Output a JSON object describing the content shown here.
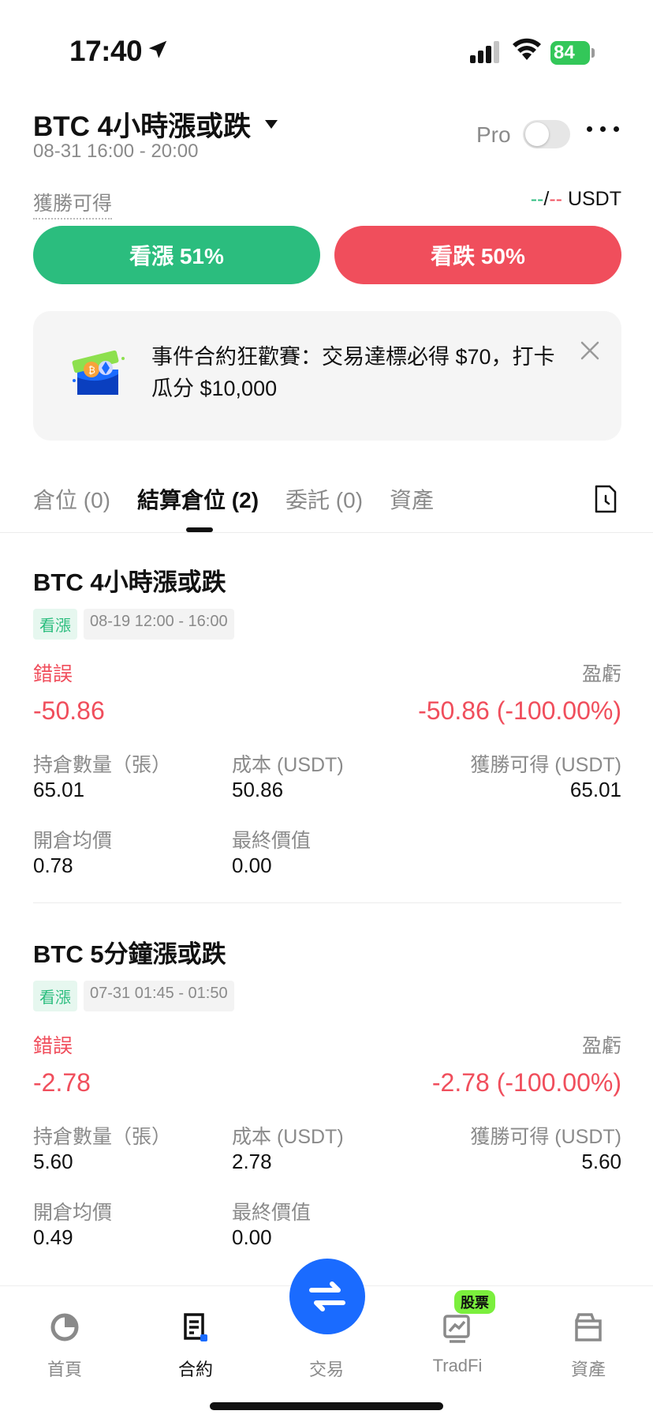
{
  "status": {
    "time": "17:40",
    "battery": "84"
  },
  "header": {
    "title": "BTC 4小時漲或跌",
    "subtitle": "08-31 16:00 - 20:00",
    "pro_label": "Pro"
  },
  "win": {
    "label": "獲勝可得",
    "unit": "USDT"
  },
  "buttons": {
    "up": "看漲 51%",
    "down": "看跌 50%"
  },
  "banner": {
    "text": "事件合約狂歡賽：交易達標必得 $70，打卡瓜分 $10,000"
  },
  "tabs": [
    {
      "label": "倉位 (0)"
    },
    {
      "label": "結算倉位 (2)"
    },
    {
      "label": "委託 (0)"
    },
    {
      "label": "資產"
    }
  ],
  "positions": [
    {
      "title": "BTC 4小時漲或跌",
      "tag": "看漲",
      "period": "08-19 12:00 - 16:00",
      "result_label": "錯誤",
      "pnl_label": "盈虧",
      "result_value": "-50.86",
      "pnl_value": "-50.86 (-100.00%)",
      "qty_label": "持倉數量（張）",
      "qty": "65.01",
      "cost_label": "成本 (USDT)",
      "cost": "50.86",
      "win_label": "獲勝可得 (USDT)",
      "win": "65.01",
      "open_label": "開倉均價",
      "open": "0.78",
      "final_label": "最終價值",
      "final": "0.00"
    },
    {
      "title": "BTC 5分鐘漲或跌",
      "tag": "看漲",
      "period": "07-31 01:45 - 01:50",
      "result_label": "錯誤",
      "pnl_label": "盈虧",
      "result_value": "-2.78",
      "pnl_value": "-2.78 (-100.00%)",
      "qty_label": "持倉數量（張）",
      "qty": "5.60",
      "cost_label": "成本 (USDT)",
      "cost": "2.78",
      "win_label": "獲勝可得 (USDT)",
      "win": "5.60",
      "open_label": "開倉均價",
      "open": "0.49",
      "final_label": "最終價值",
      "final": "0.00"
    }
  ],
  "nav": {
    "home": "首頁",
    "contract": "合約",
    "trade": "交易",
    "tradfi": "TradFi",
    "tradfi_badge": "股票",
    "assets": "資產"
  },
  "colors": {
    "up": "#2bbd7e",
    "down": "#f04e5c",
    "primary": "#1a6bff"
  }
}
